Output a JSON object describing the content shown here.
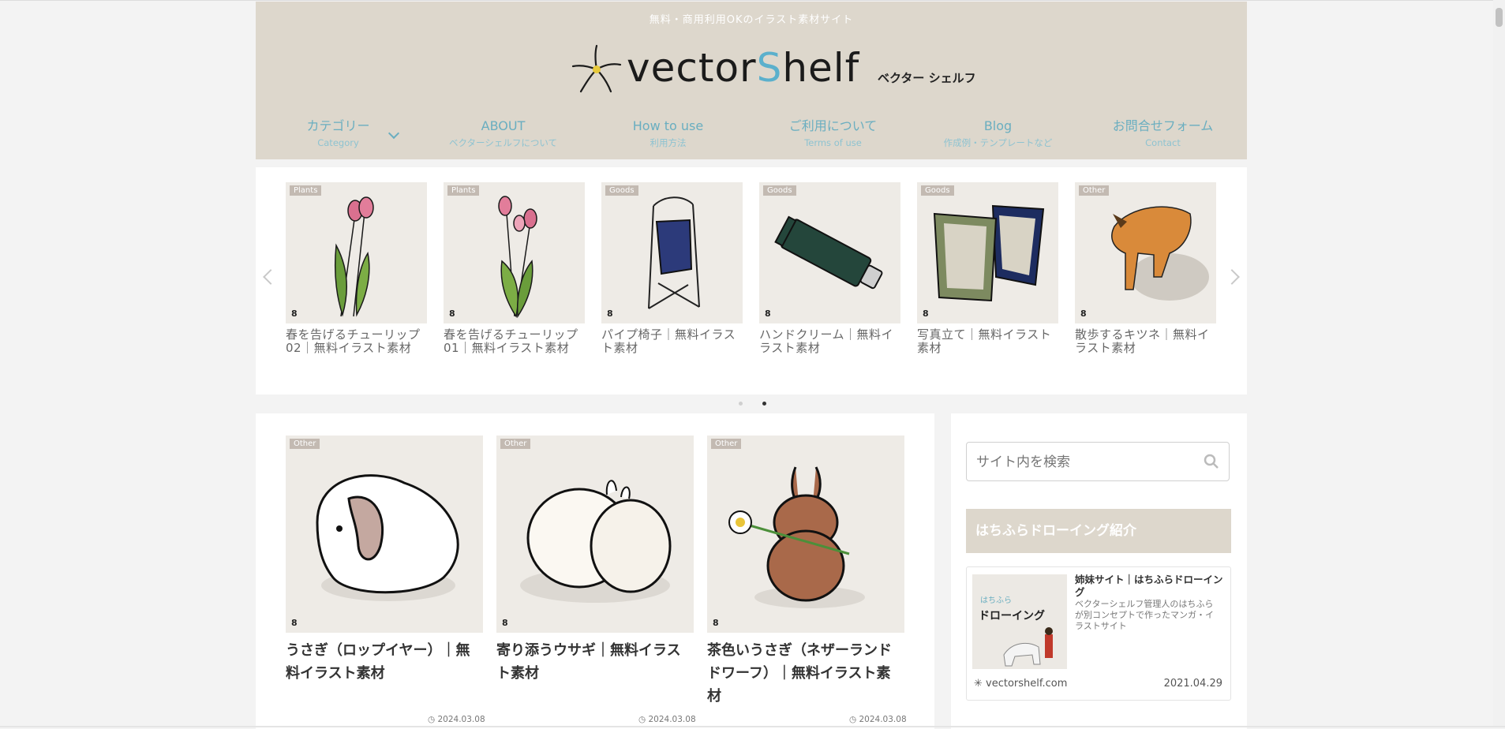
{
  "header": {
    "tagline": "無料・商用利用OKのイラスト素材サイト",
    "logo_text_a": "vector",
    "logo_text_s": "S",
    "logo_text_b": "helf",
    "logo_kana": "ベクター シェルフ",
    "nav": [
      {
        "main": "カテゴリー",
        "sub": "Category"
      },
      {
        "main": "ABOUT",
        "sub": "ベクターシェルフについて"
      },
      {
        "main": "How to use",
        "sub": "利用方法"
      },
      {
        "main": "ご利用について",
        "sub": "Terms of use"
      },
      {
        "main": "Blog",
        "sub": "作成例・テンプレートなど"
      },
      {
        "main": "お問合せフォーム",
        "sub": "Contact"
      }
    ]
  },
  "carousel": {
    "items": [
      {
        "tag": "Plants",
        "title": "春を告げるチューリップ02｜無料イラスト素材"
      },
      {
        "tag": "Plants",
        "title": "春を告げるチューリップ01｜無料イラスト素材"
      },
      {
        "tag": "Goods",
        "title": "パイプ椅子｜無料イラスト素材"
      },
      {
        "tag": "Goods",
        "title": "ハンドクリーム｜無料イラスト素材"
      },
      {
        "tag": "Goods",
        "title": "写真立て｜無料イラスト素材"
      },
      {
        "tag": "Other",
        "title": "散歩するキツネ｜無料イラスト素材"
      }
    ],
    "thumb_mark": "8"
  },
  "posts": [
    {
      "tag": "Other",
      "title": "うさぎ（ロップイヤー）｜無料イラスト素材",
      "date": "2024.03.08"
    },
    {
      "tag": "Other",
      "title": "寄り添うウサギ｜無料イラスト素材",
      "date": "2024.03.08"
    },
    {
      "tag": "Other",
      "title": "茶色いうさぎ（ネザーランドドワーフ）｜無料イラスト素材",
      "date": "2024.03.08"
    }
  ],
  "sidebar": {
    "search_placeholder": "サイト内を検索",
    "widget_title": "はちふらドローイング紹介",
    "card": {
      "title": "姉妹サイト｜はちふらドローイング",
      "desc": "ベクターシェルフ管理人のはちふらが別コンセプトで作ったマンガ・イラストサイト",
      "thumb_text": "ドローイング",
      "thumb_small": "はちふら",
      "site": "vectorshelf.com",
      "date": "2021.04.29"
    }
  },
  "colors": {
    "header_bg": "#ddd7cc",
    "nav_text": "#6aaec0",
    "logo_accent": "#5bb0cc",
    "thumb_bg": "#eeebe6"
  }
}
